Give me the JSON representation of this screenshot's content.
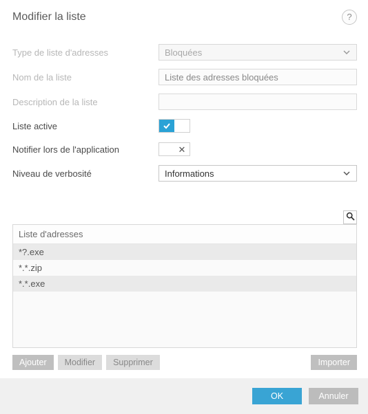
{
  "header": {
    "title": "Modifier la liste"
  },
  "fields": {
    "type_label": "Type de liste d'adresses",
    "type_value": "Bloquées",
    "name_label": "Nom de la liste",
    "name_value": "Liste des adresses bloquées",
    "desc_label": "Description de la liste",
    "desc_value": "",
    "active_label": "Liste active",
    "notify_label": "Notifier lors de l'application",
    "verbosity_label": "Niveau de verbosité",
    "verbosity_value": "Informations"
  },
  "table": {
    "header": "Liste d'adresses",
    "rows": [
      "*?.exe",
      "*.*.zip",
      "*.*.exe"
    ]
  },
  "actions": {
    "add": "Ajouter",
    "edit": "Modifier",
    "del": "Supprimer",
    "import": "Importer"
  },
  "footer": {
    "ok": "OK",
    "cancel": "Annuler"
  }
}
